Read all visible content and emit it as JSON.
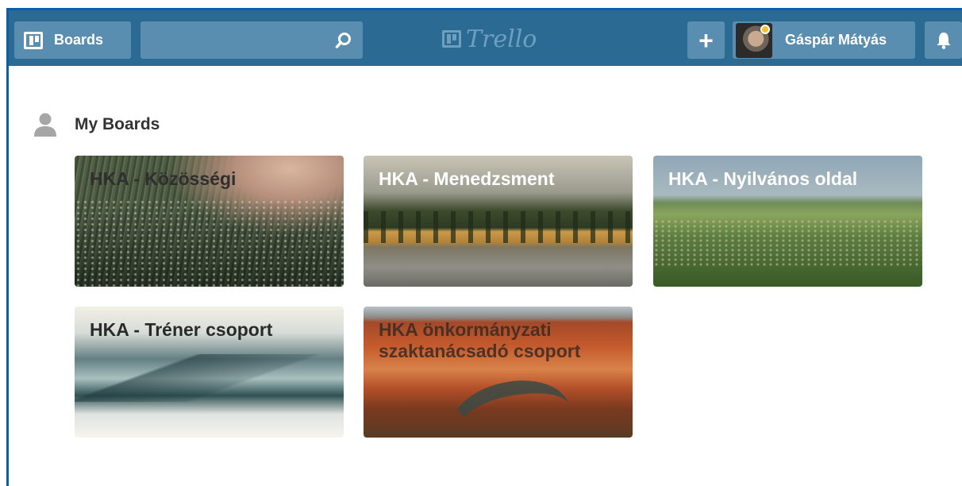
{
  "header": {
    "boards_label": "Boards",
    "search_value": "",
    "search_placeholder": "",
    "logo_text": "Trello",
    "user_name": "Gáspár Mátyás"
  },
  "icons": {
    "boards": "boards-icon",
    "search": "search-icon",
    "logo": "trello-logo-icon",
    "add": "plus-icon",
    "notifications": "bell-icon",
    "section": "person-icon"
  },
  "colors": {
    "header_bg": "#2b6b93",
    "header_button": "#5a8eb0",
    "frame": "#0b5fa6"
  },
  "section": {
    "title": "My Boards"
  },
  "boards": [
    {
      "label": "HKA - Közösségi"
    },
    {
      "label": "HKA - Menedzsment"
    },
    {
      "label": "HKA - Nyilvános oldal"
    },
    {
      "label": "HKA - Tréner csoport"
    },
    {
      "label": "HKA önkormányzati szaktanácsadó csoport"
    }
  ]
}
